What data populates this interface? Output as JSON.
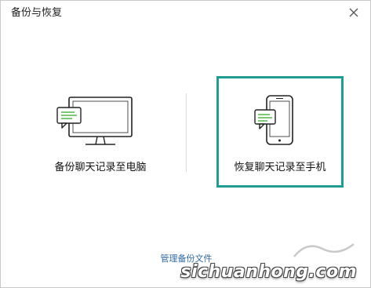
{
  "window": {
    "title": "备份与恢复"
  },
  "options": {
    "backup_to_pc": "备份聊天记录至电脑",
    "restore_to_phone": "恢复聊天记录至手机"
  },
  "footer": {
    "manage_link": "管理备份文件"
  },
  "watermark": {
    "text": "sichuanhong.com"
  },
  "colors": {
    "accent": "#1f9d94",
    "chat_bubble": "#52b846",
    "link": "#2e6aa6"
  },
  "icons": [
    "close-icon",
    "monitor-chat-icon",
    "phone-chat-icon"
  ]
}
